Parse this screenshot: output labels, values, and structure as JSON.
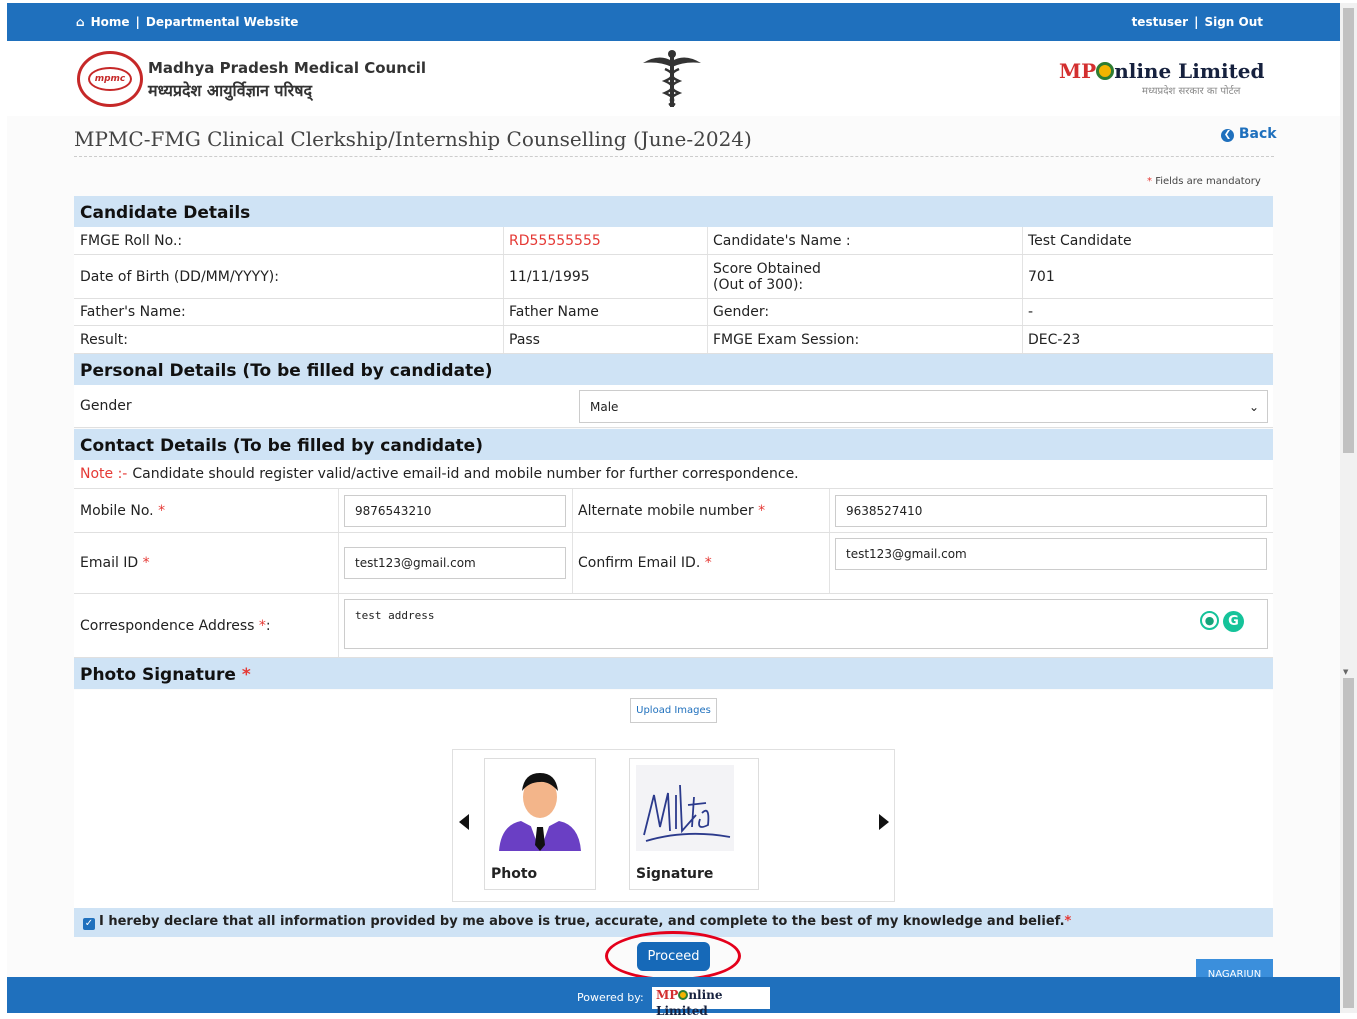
{
  "topbar": {
    "home": "Home",
    "sep": "|",
    "dept": "Departmental Website",
    "user": "testuser",
    "signout": "Sign Out"
  },
  "header": {
    "org_en": "Madhya Pradesh Medical Council",
    "org_hi": "मध्यप्रदेश आयुर्विज्ञान परिषद्",
    "logo_text": "mpmc",
    "mpo_a": "MP",
    "mpo_b": "nline Limited",
    "mpo_sub": "मध्यप्रदेश सरकार का पोर्टल"
  },
  "page": {
    "title": "MPMC-FMG Clinical Clerkship/Internship Counselling (June-2024)",
    "back": "Back",
    "mandatory": "Fields are mandatory",
    "star": "*"
  },
  "candidate": {
    "heading": "Candidate Details",
    "roll_label": "FMGE Roll No.:",
    "roll": "RD55555555",
    "name_label": "Candidate's Name :",
    "name": "Test Candidate",
    "dob_label": "Date of Birth (DD/MM/YYYY):",
    "dob": "11/11/1995",
    "score_label_1": "Score Obtained",
    "score_label_2": "(Out of 300):",
    "score": "701",
    "father_label": "Father's Name:",
    "father": "Father Name",
    "gender_label": "Gender:",
    "gender": "-",
    "result_label": "Result:",
    "result": "Pass",
    "session_label": "FMGE Exam Session:",
    "session": "DEC-23"
  },
  "personal": {
    "heading": "Personal Details (To be filled by candidate)",
    "gender_label": "Gender",
    "gender_value": "Male"
  },
  "contact": {
    "heading": "Contact Details (To be filled by candidate)",
    "note_label": "Note :-",
    "note": "Candidate should register valid/active email-id and mobile number for further correspondence.",
    "mobile_label": "Mobile No.",
    "mobile": "9876543210",
    "alt_label": "Alternate mobile number",
    "alt": "9638527410",
    "email_label": "Email ID",
    "email": "test123@gmail.com",
    "confirm_label": "Confirm Email ID.",
    "confirm": "test123@gmail.com",
    "address_label": "Correspondence Address",
    "address_suffix": ":",
    "address": "test address"
  },
  "photo": {
    "heading": "Photo Signature",
    "upload": "Upload Images",
    "photo_caption": "Photo",
    "sign_caption": "Signature"
  },
  "declaration": {
    "text": "I hereby declare that all information provided by me above is true, accurate, and complete to the best of my knowledge and belief.",
    "checked": true
  },
  "actions": {
    "proceed": "Proceed",
    "badge": "NAGARJUN"
  },
  "footer": {
    "powered": "Powered by:",
    "mpo_a": "MP",
    "mpo_b": "nline Limited"
  },
  "colors": {
    "primary": "#1f70bd",
    "section": "#cfe3f5",
    "required": "#e53935",
    "highlight": "#e4001b"
  }
}
